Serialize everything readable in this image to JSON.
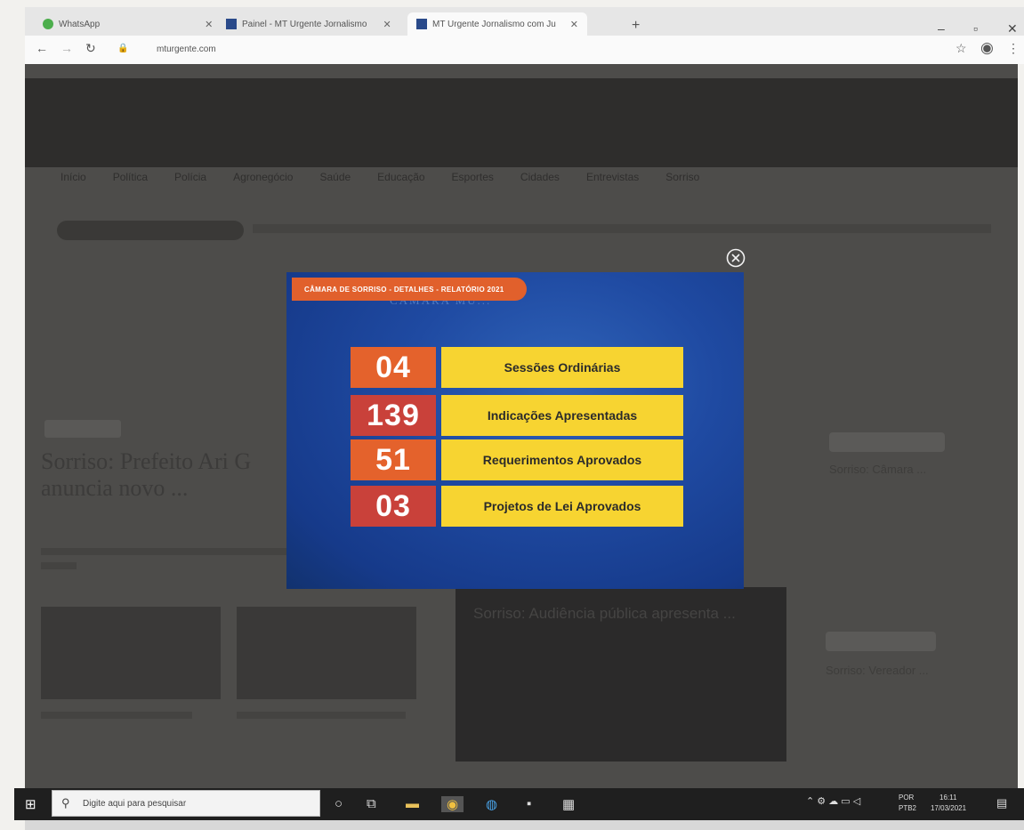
{
  "browser": {
    "tabs": [
      {
        "label": "WhatsApp"
      },
      {
        "label": "Painel - MT Urgente Jornalismo"
      },
      {
        "label": "MT Urgente Jornalismo com Ju"
      }
    ],
    "new_tab": "+",
    "url": "mturgente.com",
    "window_controls": {
      "minimize": "–",
      "maximize": "▫",
      "close": "✕"
    }
  },
  "site": {
    "nav_items": [
      "Início",
      "Política",
      "Polícia",
      "Agronegócio",
      "Saúde",
      "Educação",
      "Esportes",
      "Cidades",
      "Entrevistas",
      "Sorriso"
    ],
    "headline": "Sorriso: Prefeito Ari G anuncia novo ...",
    "dark_card_text": "Sorriso: Audiência pública apresenta ...",
    "sidebar_text_1": "Sorriso: Câmara ...",
    "sidebar_text_2": "Sorriso: Vereador ..."
  },
  "popup": {
    "tag": "CÂMARA DE SORRISO - DETALHES - RELATÓRIO 2021",
    "bg_text": "CÂMARA MU...",
    "stats": [
      {
        "number": "04",
        "label": "Sessões Ordinárias",
        "color": "#e4622c"
      },
      {
        "number": "139",
        "label": "Indicações Apresentadas",
        "color": "#c9413a"
      },
      {
        "number": "51",
        "label": "Requerimentos Aprovados",
        "color": "#e4622c"
      },
      {
        "number": "03",
        "label": "Projetos de Lei Aprovados",
        "color": "#c9413a"
      }
    ]
  },
  "taskbar": {
    "search_placeholder": "Digite aqui para pesquisar",
    "lang": "POR",
    "lang_sub": "PTB2",
    "time": "16:11",
    "date": "17/03/2021"
  },
  "colors": {
    "accent_orange": "#e4622c",
    "accent_red": "#c9413a",
    "label_yellow": "#f7d431",
    "popup_blue": "#1f4aa2"
  }
}
